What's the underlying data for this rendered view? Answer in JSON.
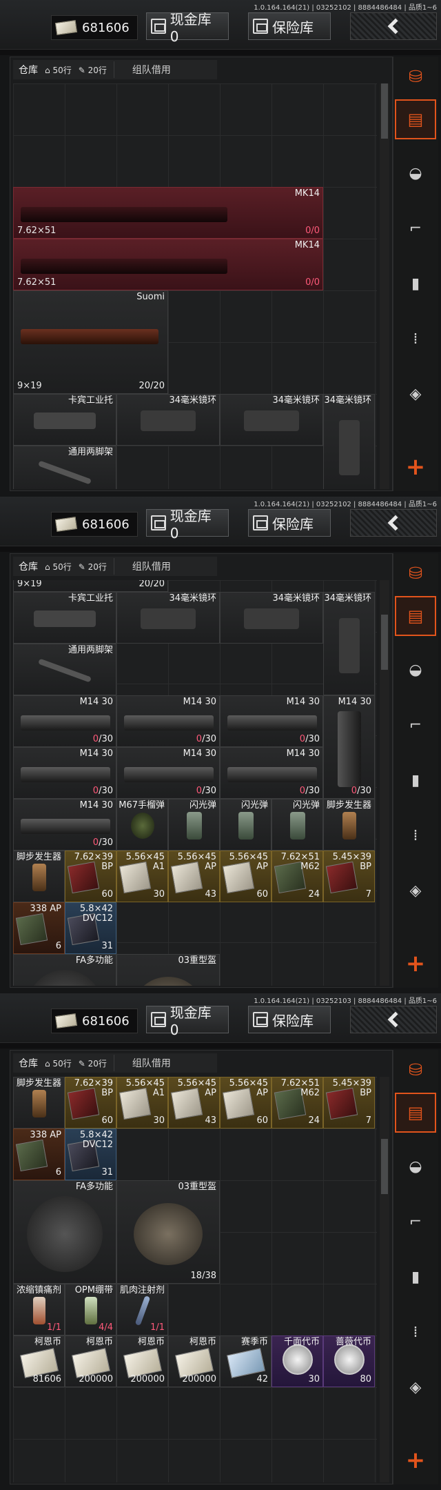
{
  "version": "1.0.164.164(21) | 03252102 | 8884486484 | 品质1~6",
  "version2": "1.0.164.164(21) | 03252102 | 8884486484 | 品质1~6",
  "version3": "1.0.164.164(21) | 03252103 | 8884486484 | 品质1~6",
  "header": {
    "money": "681606",
    "cash_label": "现金库 0",
    "safe_label": "保险库"
  },
  "tabs": {
    "warehouse": "仓库",
    "rows50": "50行",
    "rows20": "20行",
    "team": "组队借用"
  },
  "p1": {
    "items": [
      {
        "name": "MK14",
        "caliber": "7.62×51",
        "count": "0/0"
      },
      {
        "name": "MK14",
        "caliber": "7.62×51",
        "count": "0/0"
      },
      {
        "name": "Suomi",
        "caliber": "9×19",
        "count": "20/20"
      },
      {
        "name": "卡宾工业托"
      },
      {
        "name": "34毫米镜环"
      },
      {
        "name": "34毫米镜环"
      },
      {
        "name": "34毫米镜环"
      },
      {
        "name": "通用两脚架"
      }
    ]
  },
  "p2": {
    "top_cal": "9×19",
    "top_count": "20/20",
    "row1": [
      "卡宾工业托",
      "34毫米镜环",
      "34毫米镜环",
      "34毫米镜环"
    ],
    "bipod": "通用两脚架",
    "mags": [
      {
        "name": "M14 30",
        "count": "0/30"
      },
      {
        "name": "M14 30",
        "count": "0/30"
      },
      {
        "name": "M14 30",
        "count": "0/30"
      },
      {
        "name": "M14 30",
        "count": "0/30"
      },
      {
        "name": "M14 30",
        "count": "0/30"
      },
      {
        "name": "M14 30",
        "count": "0/30"
      },
      {
        "name": "M14 30",
        "count": "0/30"
      },
      {
        "name": "M14 30",
        "count": "0/30"
      },
      {
        "name": "M14 30",
        "count": "0/30"
      }
    ],
    "row5": [
      "M67手榴弹",
      "闪光弹",
      "闪光弹",
      "闪光弹",
      "脚步发生器"
    ],
    "ammo": [
      {
        "name": "脚步发生器",
        "count": ""
      },
      {
        "name": "7.62×39 BP",
        "count": "60"
      },
      {
        "name": "5.56×45 A1",
        "count": "30"
      },
      {
        "name": "5.56×45 AP",
        "count": "43"
      },
      {
        "name": "5.56×45 AP",
        "count": "60"
      },
      {
        "name": "7.62×51 M62",
        "count": "24"
      },
      {
        "name": "5.45×39 BP",
        "count": "7"
      }
    ],
    "ammo2": [
      {
        "name": "338 AP",
        "count": "6"
      },
      {
        "name": "5.8×42 DVC12",
        "count": "31"
      }
    ],
    "bottom": [
      "FA多功能",
      "03重型盔"
    ]
  },
  "p3": {
    "ammo": [
      {
        "name": "脚步发生器",
        "count": ""
      },
      {
        "name": "7.62×39 BP",
        "count": "60"
      },
      {
        "name": "5.56×45 A1",
        "count": "30"
      },
      {
        "name": "5.56×45 AP",
        "count": "43"
      },
      {
        "name": "5.56×45 AP",
        "count": "60"
      },
      {
        "name": "7.62×51 M62",
        "count": "24"
      },
      {
        "name": "5.45×39 BP",
        "count": "7"
      }
    ],
    "ammo2": [
      {
        "name": "338 AP",
        "count": "6"
      },
      {
        "name": "5.8×42 DVC12",
        "count": "31"
      }
    ],
    "bag": "FA多功能",
    "helmet": "03重型盔",
    "helmet_count": "18/38",
    "meds": [
      {
        "name": "浓缩镇痛剂",
        "count": "1/1"
      },
      {
        "name": "OPM绷带",
        "count": "4/4"
      },
      {
        "name": "肌肉注射剂",
        "count": "1/1"
      }
    ],
    "currency": [
      {
        "name": "柯恩币",
        "count": "81606"
      },
      {
        "name": "柯恩币",
        "count": "200000"
      },
      {
        "name": "柯恩币",
        "count": "200000"
      },
      {
        "name": "柯恩币",
        "count": "200000"
      },
      {
        "name": "赛季币",
        "count": "42"
      },
      {
        "name": "千面代币",
        "count": "30"
      },
      {
        "name": "蔷薇代币",
        "count": "80"
      }
    ]
  }
}
